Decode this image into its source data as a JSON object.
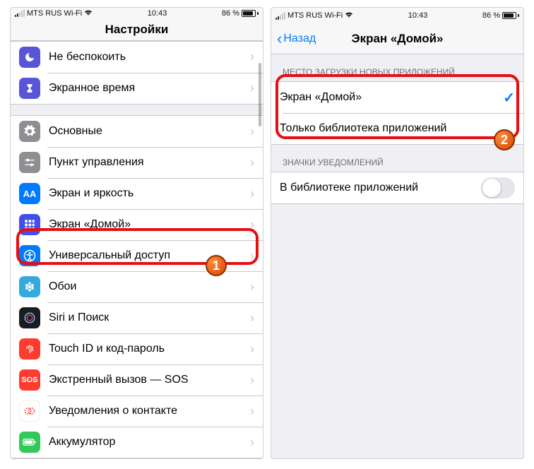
{
  "status": {
    "carrier": "MTS RUS Wi-Fi",
    "time": "10:43",
    "battery_text": "86 %"
  },
  "left": {
    "title": "Настройки",
    "rows": {
      "dnd": "Не беспокоить",
      "screentime": "Экранное время",
      "general": "Основные",
      "control": "Пункт управления",
      "display": "Экран и яркость",
      "home": "Экран «Домой»",
      "access": "Универсальный доступ",
      "wallpaper": "Обои",
      "siri": "Siri и Поиск",
      "touch": "Touch ID и код-пароль",
      "sos": "Экстренный вызов — SOS",
      "sos_icon": "SOS",
      "med": "Уведомления о контакте",
      "battery": "Аккумулятор"
    }
  },
  "right": {
    "back": "Назад",
    "title": "Экран «Домой»",
    "section1": "МЕСТО ЗАГРУЗКИ НОВЫХ ПРИЛОЖЕНИЙ",
    "opt_home": "Экран «Домой»",
    "opt_lib": "Только библиотека приложений",
    "section2": "ЗНАЧКИ УВЕДОМЛЕНИЙ",
    "opt_badges": "В библиотеке приложений"
  },
  "annotations": {
    "step1": "1",
    "step2": "2"
  }
}
